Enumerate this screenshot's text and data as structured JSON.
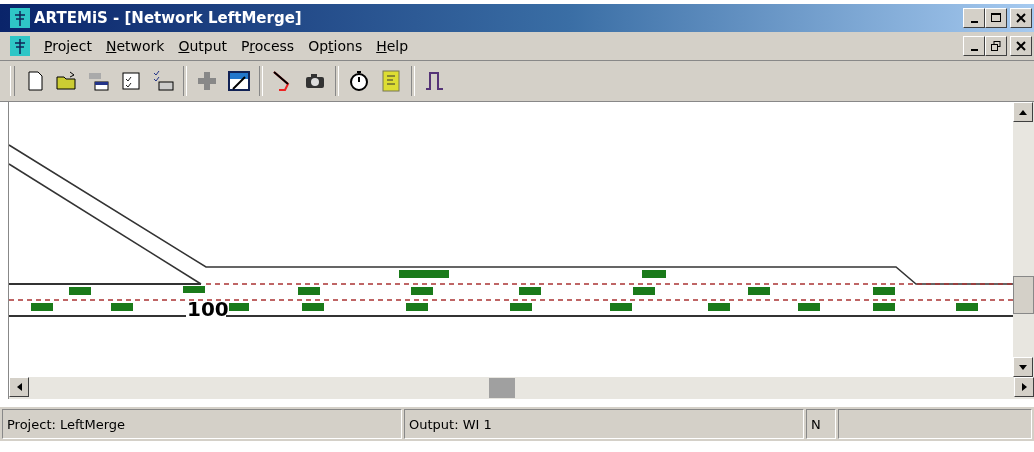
{
  "window": {
    "title": "ARTEMiS - [Network LeftMerge]"
  },
  "menu": [
    {
      "hotkey": "P",
      "rest": "roject"
    },
    {
      "hotkey": "N",
      "rest": "etwork"
    },
    {
      "hotkey": "O",
      "rest": "utput"
    },
    {
      "before": "P",
      "hotkey": "r",
      "rest": "ocess"
    },
    {
      "before": "Op",
      "hotkey": "t",
      "rest": "ions"
    },
    {
      "hotkey": "H",
      "rest": "elp"
    }
  ],
  "network": {
    "link_label": "100"
  },
  "status_bar": [
    "Project: LeftMerge",
    "Output: WI 1",
    "N"
  ]
}
